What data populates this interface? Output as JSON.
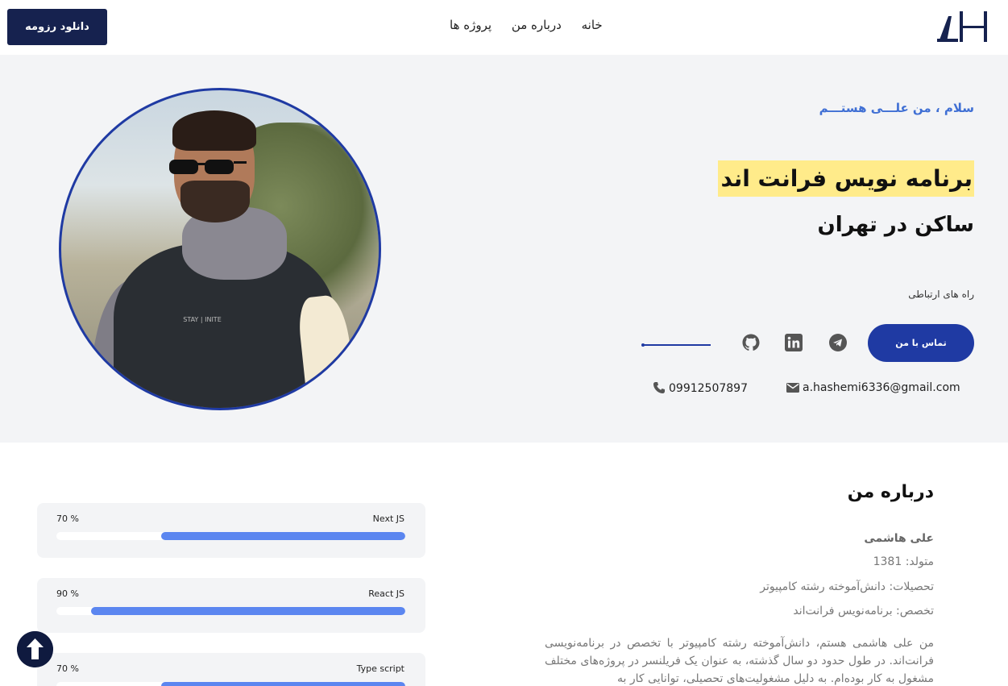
{
  "header": {
    "logo_text": "AH",
    "nav": [
      "خانه",
      "درباره من",
      "پروژه ها"
    ],
    "download_label": "دانلود رزومه"
  },
  "hero": {
    "greeting": "سلام ، من علـــی هستـــم",
    "title": "برنامه نویس فرانت اند",
    "subtitle": "ساکن در تهران",
    "contact_ways_label": "راه های ارتباطی",
    "contact_button": "تماس با من",
    "photo_print_text": "STAY | INITE",
    "email": "a.hashemi6336@gmail.com",
    "phone": "09912507897",
    "social_icons": [
      "telegram-icon",
      "linkedin-icon",
      "github-icon"
    ]
  },
  "about": {
    "title": "درباره من",
    "name": "علی هاشمی",
    "born": "متولد: 1381",
    "education": "تحصیلات: دانش‌آموخته رشته کامپیوتر",
    "specialty": "تخصص: برنامه‌نویس فرانت‌اند",
    "paragraph": "من علی هاشمی هستم، دانش‌آموخته رشته کامپیوتر با تخصص در برنامه‌نویسی فرانت‌اند. در طول حدود دو سال گذشته، به عنوان یک فریلنسر در پروژه‌های مختلف مشغول به کار بوده‌ام. به دلیل مشغولیت‌های تحصیلی، توانایی کار به"
  },
  "skills": [
    {
      "name": "Next JS",
      "percent_label": "70 %",
      "level": 0.7
    },
    {
      "name": "React JS",
      "percent_label": "90 %",
      "level": 0.9
    },
    {
      "name": "Type script",
      "percent_label": "70 %",
      "level": 0.7
    }
  ],
  "colors": {
    "primary": "#1f3aa3",
    "navy": "#16224f",
    "highlight": "#ffeb8a",
    "accent_text": "#3f6fd4",
    "progress": "#5b86f0"
  }
}
